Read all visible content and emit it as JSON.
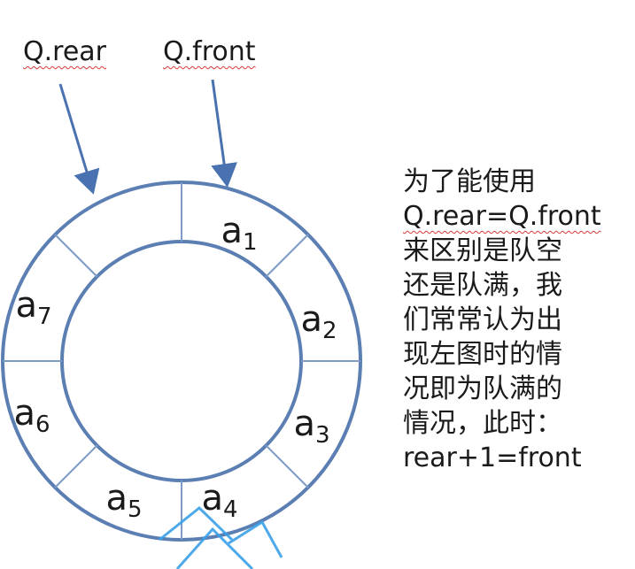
{
  "pointers": {
    "rear_label": "Q.rear",
    "front_label": "Q.front"
  },
  "slots": [
    {
      "base": "a",
      "index": "1"
    },
    {
      "base": "a",
      "index": "2"
    },
    {
      "base": "a",
      "index": "3"
    },
    {
      "base": "a",
      "index": "4"
    },
    {
      "base": "a",
      "index": "5"
    },
    {
      "base": "a",
      "index": "6"
    },
    {
      "base": "a",
      "index": "7"
    }
  ],
  "explanation": {
    "lines": [
      "为了能使用",
      "Q.rear=Q.front",
      "来区别是队空",
      "还是队满，我",
      "们常常认为出",
      "现左图时的情",
      "况即为队满的",
      "情况，此时：",
      "rear+1=front"
    ]
  },
  "colors": {
    "ring": "#5b7fb3",
    "divider": "#7e9bc4",
    "arrow": "#4a72b0",
    "text": "#1a1a1a",
    "squiggle": "#d83a3a",
    "watermark": "#3aa0e8"
  }
}
